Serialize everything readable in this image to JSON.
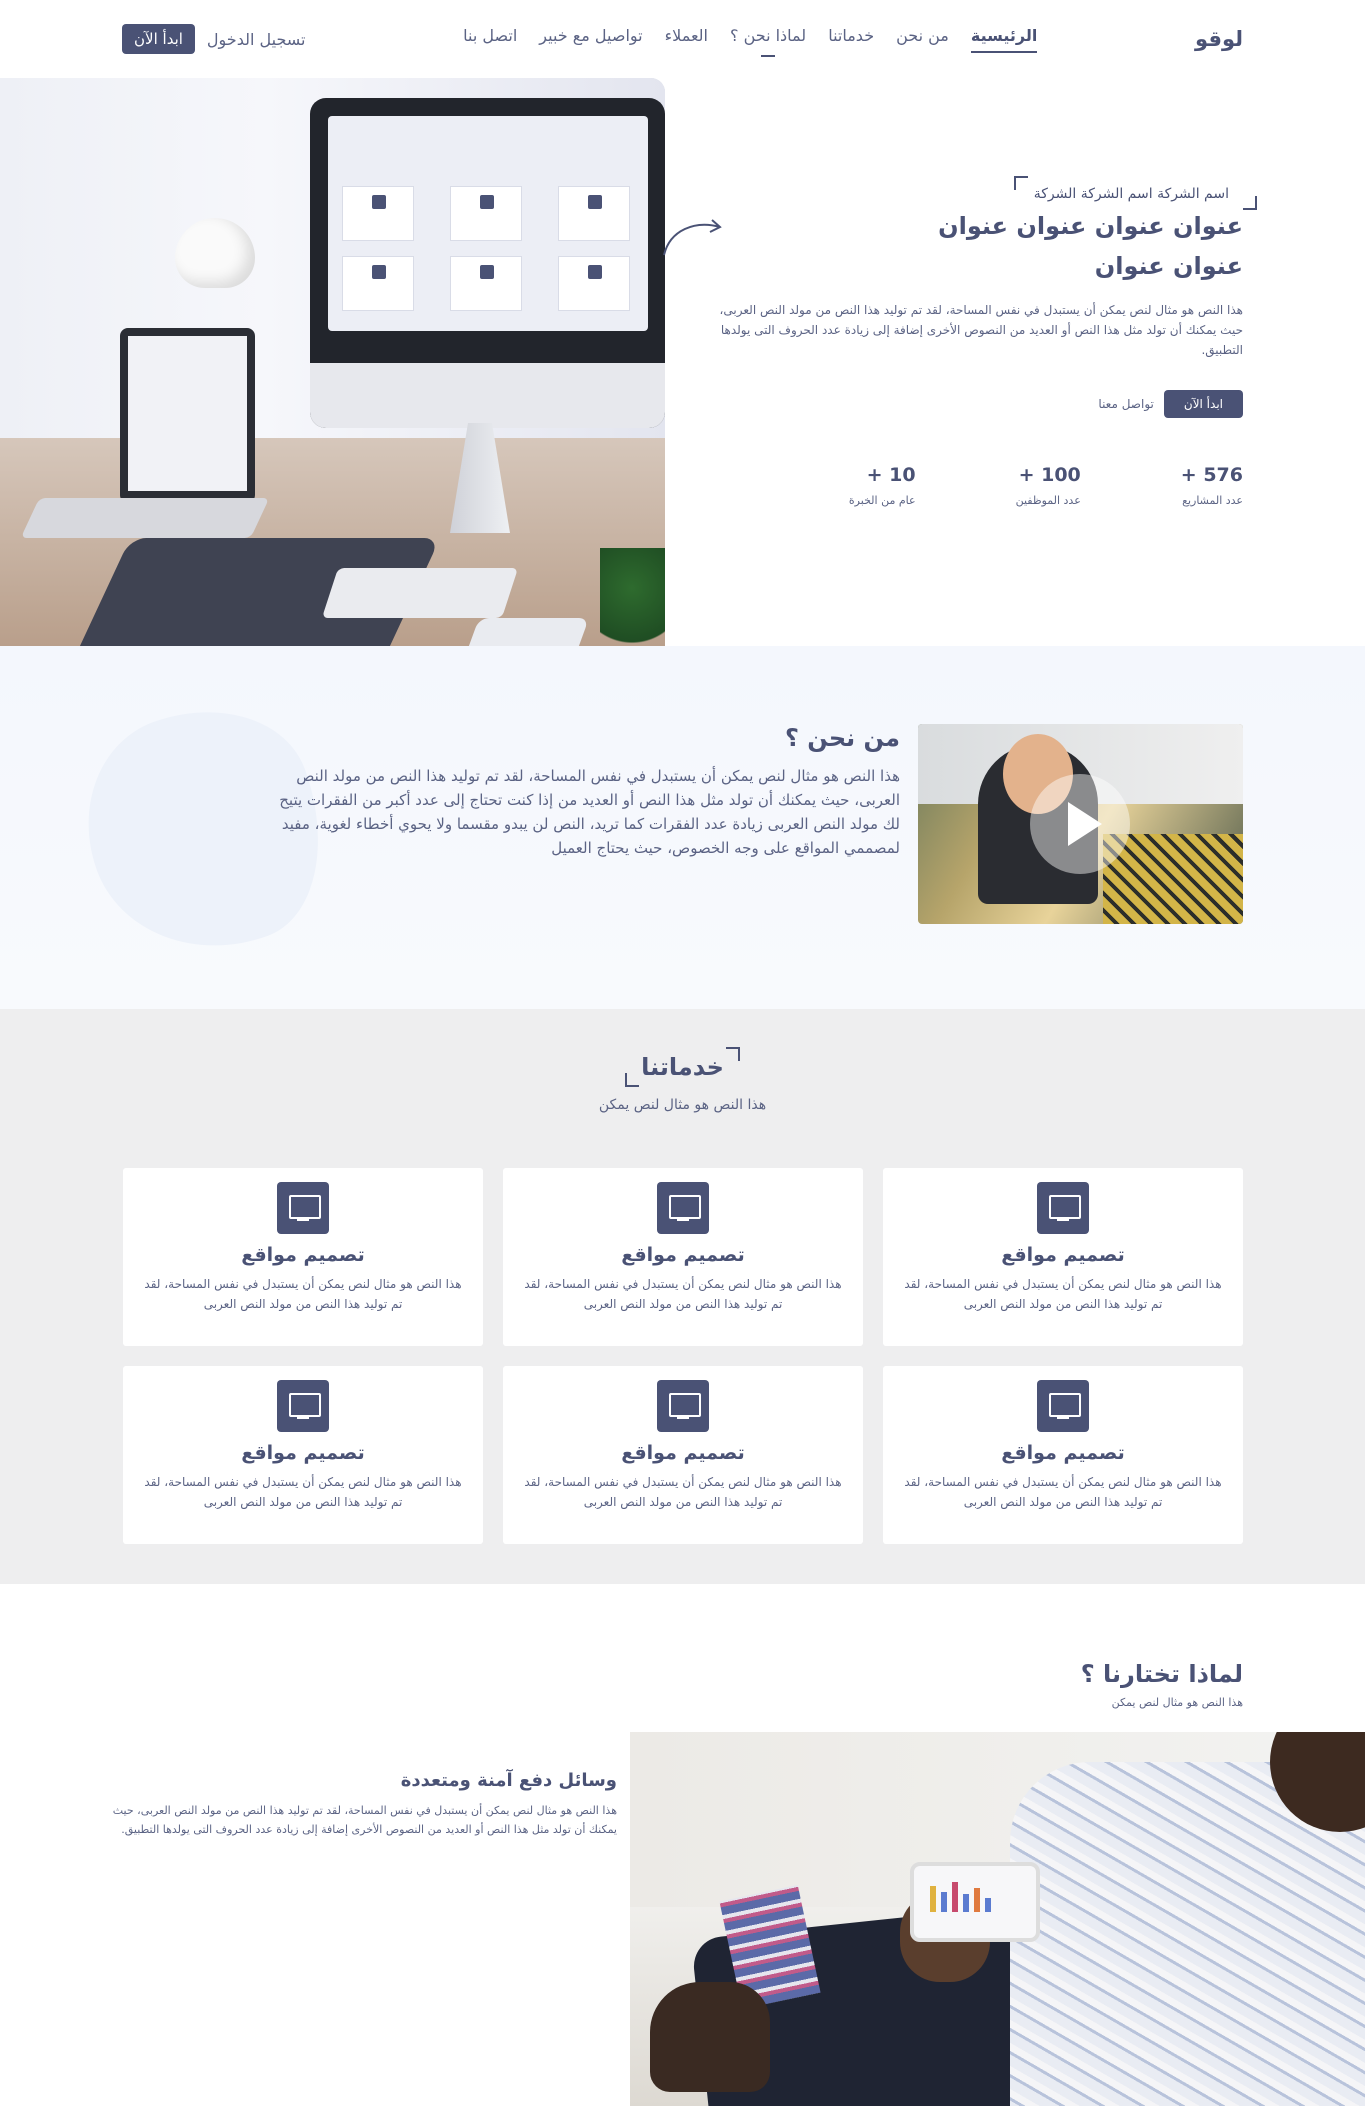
{
  "nav": {
    "logo": "لوقو",
    "items": [
      "الرئيسية",
      "من نحن",
      "خدماتنا",
      "لماذا نحن ؟",
      "العملاء",
      "تواصيل مع خبير",
      "اتصل بنا"
    ],
    "login": "تسجيل الدخول",
    "start": "ابدأ الآن"
  },
  "hero": {
    "tag": "اسم الشركة اسم الشركة الشركة",
    "title_line1": "عنوان عنوان عنوان عنوان",
    "title_line2": "عنوان عنوان",
    "desc": "هذا النص هو مثال لنص يمكن أن يستبدل في نفس المساحة، لقد تم توليد هذا النص من مولد النص العربى، حيث يمكنك أن تولد مثل هذا النص أو العديد من النصوص الأخرى إضافة إلى زيادة عدد الحروف التى يولدها التطبيق.",
    "btn_start": "ابدأ الآن",
    "btn_contact": "تواصل معنا",
    "stats": [
      {
        "num": "576 +",
        "label": "عدد المشاريع"
      },
      {
        "num": "100 +",
        "label": "عدد الموظفين"
      },
      {
        "num": "10 +",
        "label": "عام من الخبرة"
      }
    ]
  },
  "about": {
    "title": "من نحن ؟",
    "desc": "هذا النص هو مثال لنص يمكن أن يستبدل في نفس المساحة، لقد تم توليد هذا النص من مولد النص العربى، حيث يمكنك أن تولد مثل هذا النص أو العديد من إذا كنت تحتاج إلى عدد أكبر من الفقرات يتيح لك مولد النص العربى زيادة عدد الفقرات كما تريد، النص لن يبدو مقسما ولا يحوي أخطاء لغوية، مفيد لمصممي المواقع على وجه الخصوص، حيث يحتاج العميل"
  },
  "services": {
    "title": "خدماتنا",
    "subtitle": "هذا النص هو مثال لنص يمكن",
    "cards": [
      {
        "title": "تصميم مواقع",
        "desc": "هذا النص هو مثال لنص يمكن أن يستبدل في نفس المساحة، لقد تم توليد هذا النص من مولد النص العربى"
      },
      {
        "title": "تصميم مواقع",
        "desc": "هذا النص هو مثال لنص يمكن أن يستبدل في نفس المساحة، لقد تم توليد هذا النص من مولد النص العربى"
      },
      {
        "title": "تصميم مواقع",
        "desc": "هذا النص هو مثال لنص يمكن أن يستبدل في نفس المساحة، لقد تم توليد هذا النص من مولد النص العربى"
      },
      {
        "title": "تصميم مواقع",
        "desc": "هذا النص هو مثال لنص يمكن أن يستبدل في نفس المساحة، لقد تم توليد هذا النص من مولد النص العربى"
      },
      {
        "title": "تصميم مواقع",
        "desc": "هذا النص هو مثال لنص يمكن أن يستبدل في نفس المساحة، لقد تم توليد هذا النص من مولد النص العربى"
      },
      {
        "title": "تصميم مواقع",
        "desc": "هذا النص هو مثال لنص يمكن أن يستبدل في نفس المساحة، لقد تم توليد هذا النص من مولد النص العربى"
      }
    ]
  },
  "why": {
    "title": "لماذا تختارنا ؟",
    "subtitle": "هذا النص هو مثال لنص يمكن",
    "item_title": "وسائل دفع آمنة ومتعددة",
    "item_desc": "هذا النص هو مثال لنص يمكن أن يستبدل في نفس المساحة، لقد تم توليد هذا النص من مولد النص العربى، حيث يمكنك أن تولد مثل هذا النص أو العديد من النصوص الأخرى إضافة إلى زيادة عدد الحروف التى يولدها التطبيق."
  },
  "colors": {
    "primary": "#4a5275",
    "about_bg": "#f4f7fd",
    "services_bg": "#eeeeef"
  },
  "icons": [
    "play-icon",
    "web-design-icon",
    "curved-arrow-icon"
  ]
}
